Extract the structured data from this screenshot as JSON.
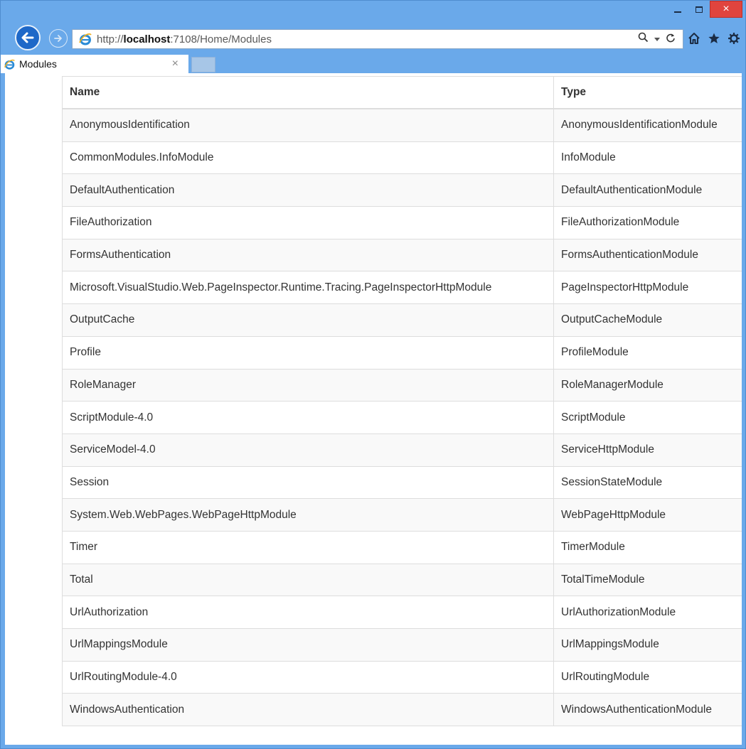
{
  "browser": {
    "url_prefix": "http://",
    "url_host": "localhost",
    "url_rest": ":7108/Home/Modules",
    "tab_title": "Modules",
    "tab_close": "×",
    "window_close": "×"
  },
  "table": {
    "headers": {
      "name": "Name",
      "type": "Type"
    },
    "rows": [
      {
        "name": "AnonymousIdentification",
        "type": "AnonymousIdentificationModule"
      },
      {
        "name": "CommonModules.InfoModule",
        "type": "InfoModule"
      },
      {
        "name": "DefaultAuthentication",
        "type": "DefaultAuthenticationModule"
      },
      {
        "name": "FileAuthorization",
        "type": "FileAuthorizationModule"
      },
      {
        "name": "FormsAuthentication",
        "type": "FormsAuthenticationModule"
      },
      {
        "name": "Microsoft.VisualStudio.Web.PageInspector.Runtime.Tracing.PageInspectorHttpModule",
        "type": "PageInspectorHttpModule"
      },
      {
        "name": "OutputCache",
        "type": "OutputCacheModule"
      },
      {
        "name": "Profile",
        "type": "ProfileModule"
      },
      {
        "name": "RoleManager",
        "type": "RoleManagerModule"
      },
      {
        "name": "ScriptModule-4.0",
        "type": "ScriptModule"
      },
      {
        "name": "ServiceModel-4.0",
        "type": "ServiceHttpModule"
      },
      {
        "name": "Session",
        "type": "SessionStateModule"
      },
      {
        "name": "System.Web.WebPages.WebPageHttpModule",
        "type": "WebPageHttpModule"
      },
      {
        "name": "Timer",
        "type": "TimerModule"
      },
      {
        "name": "Total",
        "type": "TotalTimeModule"
      },
      {
        "name": "UrlAuthorization",
        "type": "UrlAuthorizationModule"
      },
      {
        "name": "UrlMappingsModule",
        "type": "UrlMappingsModule"
      },
      {
        "name": "UrlRoutingModule-4.0",
        "type": "UrlRoutingModule"
      },
      {
        "name": "WindowsAuthentication",
        "type": "WindowsAuthenticationModule"
      }
    ]
  },
  "icons": {
    "back": "back-arrow-icon",
    "forward": "forward-arrow-icon",
    "site": "ie-logo-icon",
    "search": "search-icon",
    "refresh": "refresh-icon",
    "home": "home-icon",
    "favorites": "star-icon",
    "tools": "gear-icon"
  },
  "colors": {
    "frame": "#6aa9ea",
    "close_button": "#e0443e",
    "back_button": "#1e68c8",
    "table_border": "#dddddd",
    "stripe": "#f9f9f9"
  }
}
